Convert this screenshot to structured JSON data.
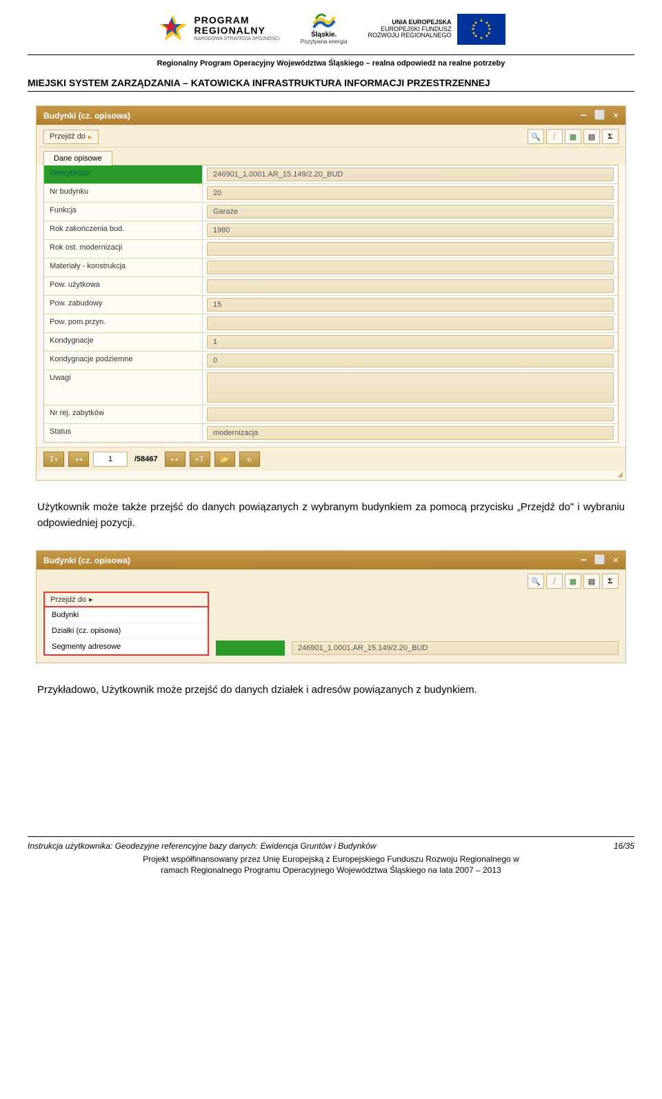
{
  "header": {
    "program_big": "PROGRAM",
    "program_big2": "REGIONALNY",
    "program_small": "NARODOWA STRATEGIA SPÓJNOŚCI",
    "slaskie1": "Śląskie.",
    "slaskie2": "Pozytywna energia",
    "ue1": "UNIA EUROPEJSKA",
    "ue2": "EUROPEJSKI FUNDUSZ",
    "ue3": "ROZWOJU REGIONALNEGO",
    "tagline": "Regionalny Program Operacyjny Województwa Śląskiego – realna odpowiedź na realne potrzeby",
    "title": "MIEJSKI SYSTEM ZARZĄDZANIA – KATOWICKA INFRASTRUKTURA INFORMACJI PRZESTRZENNEJ"
  },
  "window1": {
    "title": "Budynki (cz. opisowa)",
    "przejdz": "Przejdź do",
    "tab": "Dane opisowe",
    "rows": [
      {
        "label": "Identyfikator",
        "value": "246901_1.0001.AR_15.149/2.20_BUD",
        "highlight": true
      },
      {
        "label": "Nr budynku",
        "value": "20"
      },
      {
        "label": "Funkcja",
        "value": "Garaże"
      },
      {
        "label": "Rok zakończenia bud.",
        "value": "1980"
      },
      {
        "label": "Rok ost. modernizacji",
        "value": ""
      },
      {
        "label": "Materiały - konstrukcja",
        "value": ""
      },
      {
        "label": "Pow. użytkowa",
        "value": ""
      },
      {
        "label": "Pow. zabudowy",
        "value": "15"
      },
      {
        "label": "Pow. pom.przyn.",
        "value": ""
      },
      {
        "label": "Kondygnacje",
        "value": "1"
      },
      {
        "label": "Kondygnacje podziemne",
        "value": "0"
      },
      {
        "label": "Uwagi",
        "value": "",
        "tall": true
      },
      {
        "label": "Nr rej. zabytków",
        "value": ""
      },
      {
        "label": "Status",
        "value": "modernizacja"
      }
    ],
    "pager": {
      "current": "1",
      "total": "/58467"
    }
  },
  "para1": "Użytkownik może także przejść do danych powiązanych z wybranym budynkiem za pomocą przycisku „Przejdź do\" i wybraniu odpowiedniej pozycji.",
  "window2": {
    "title": "Budynki (cz. opisowa)",
    "przejdz": "Przejdź do",
    "items": [
      "Budynki",
      "Działki (cz. opisowa)",
      "Segmenty adresowe"
    ],
    "field_value": "246901_1.0001.AR_15.149/2.20_BUD"
  },
  "para2": "Przykładowo, Użytkownik może przejść do danych działek i adresów powiązanych z budynkiem.",
  "footer": {
    "left": "Instrukcja użytkownika: Geodezyjne referencyjne bazy danych: Ewidencja Gruntów i Budynków",
    "right": "16/35",
    "line1": "Projekt współfinansowany przez Unię Europejską z  Europejskiego Funduszu Rozwoju Regionalnego w",
    "line2": "ramach  Regionalnego Programu Operacyjnego Województwa Śląskiego na lata 2007 – 2013"
  }
}
